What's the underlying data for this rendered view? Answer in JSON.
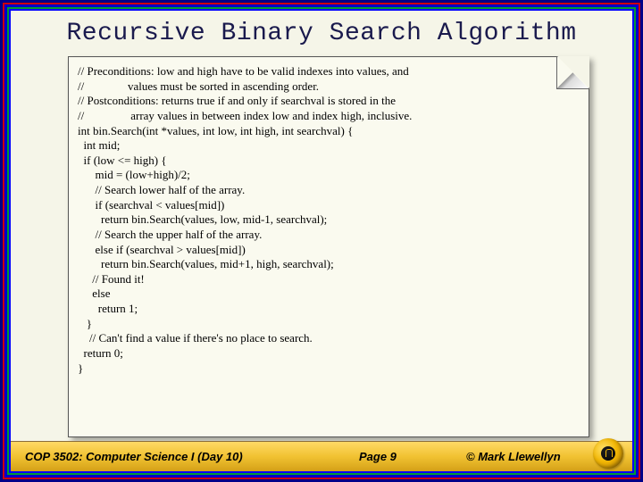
{
  "title": "Recursive Binary Search Algorithm",
  "code": "// Preconditions: low and high have to be valid indexes into values, and\n//               values must be sorted in ascending order.\n// Postconditions: returns true if and only if searchval is stored in the\n//                array values in between index low and index high, inclusive.\nint bin.Search(int *values, int low, int high, int searchval) {\n  int mid;\n  if (low <= high) {\n      mid = (low+high)/2;\n      // Search lower half of the array.\n      if (searchval < values[mid])\n        return bin.Search(values, low, mid-1, searchval);\n      // Search the upper half of the array.\n      else if (searchval > values[mid])\n        return bin.Search(values, mid+1, high, searchval);\n     // Found it!\n     else\n       return 1;\n   }\n    // Can't find a value if there's no place to search.\n  return 0;\n}",
  "footer": {
    "course": "COP 3502: Computer Science I  (Day 10)",
    "page": "Page 9",
    "copyright": "© Mark Llewellyn"
  }
}
